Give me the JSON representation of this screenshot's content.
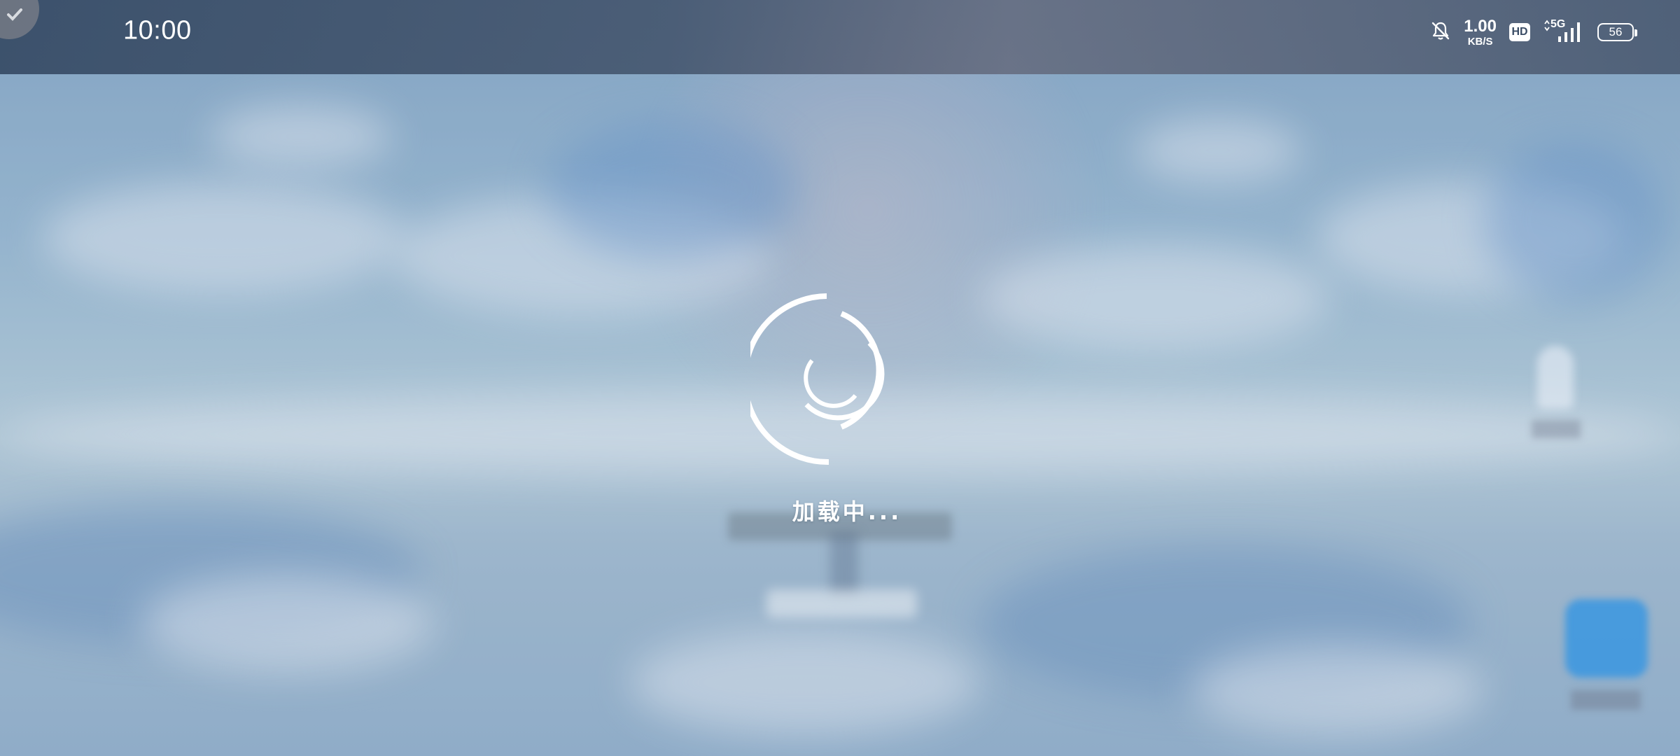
{
  "status_bar": {
    "time": "10:00",
    "network_speed_value": "1.00",
    "network_speed_unit": "KB/S",
    "hd_label": "HD",
    "network_type": "5G",
    "battery_level": "56",
    "icons": [
      "bell-muted-icon",
      "hd-icon",
      "signal-5g-icon",
      "battery-icon"
    ]
  },
  "loading": {
    "text": "加载中..."
  },
  "colors": {
    "status_bar_bg": "#3a4b66",
    "spinner": "#ffffff",
    "text": "#ffffff",
    "sky": "#93b6d1"
  }
}
